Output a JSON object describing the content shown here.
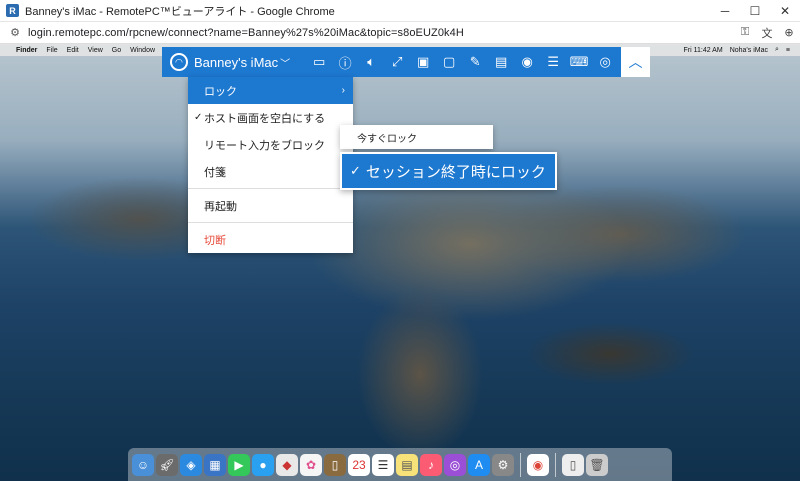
{
  "window": {
    "title": "Banney's iMac - RemotePC™ビューアライト - Google Chrome",
    "app_icon": "R",
    "minimize": "─",
    "maximize": "☐",
    "close": "✕"
  },
  "address": {
    "url": "login.remotepc.com/rpcnew/connect?name=Banney%27s%20iMac&topic=s8oEUZ0k4H",
    "icons": [
      "key-icon",
      "translate-icon",
      "zoom-icon"
    ]
  },
  "mac_menubar": {
    "items": [
      "Finder",
      "File",
      "Edit",
      "View",
      "Go",
      "Window"
    ],
    "clock": "Fri 11:42 AM",
    "user": "Noha's iMac"
  },
  "toolbar": {
    "machine_name": "Banney's iMac",
    "icons": [
      "display-icon",
      "info-icon",
      "volume-icon",
      "resize-icon",
      "chat-icon",
      "message-icon",
      "draw-icon",
      "file-transfer-icon",
      "camera-icon",
      "notes-icon",
      "keyboard-icon",
      "eye-icon",
      "help-icon"
    ],
    "collapse": "︿"
  },
  "menu": {
    "items": [
      {
        "label": "ロック",
        "active": true,
        "has_submenu": true
      },
      {
        "label": "ホスト画面を空白にする",
        "checked": true
      },
      {
        "label": "リモート入力をブロック"
      },
      {
        "label": "付箋"
      },
      {
        "label": "再起動"
      },
      {
        "label": "切断",
        "danger": true
      }
    ]
  },
  "submenu": {
    "lock_now": "今すぐロック",
    "lock_on_end": "セッション終了時にロック"
  },
  "colors": {
    "accent": "#1d78d0",
    "danger": "#e74c3c"
  }
}
